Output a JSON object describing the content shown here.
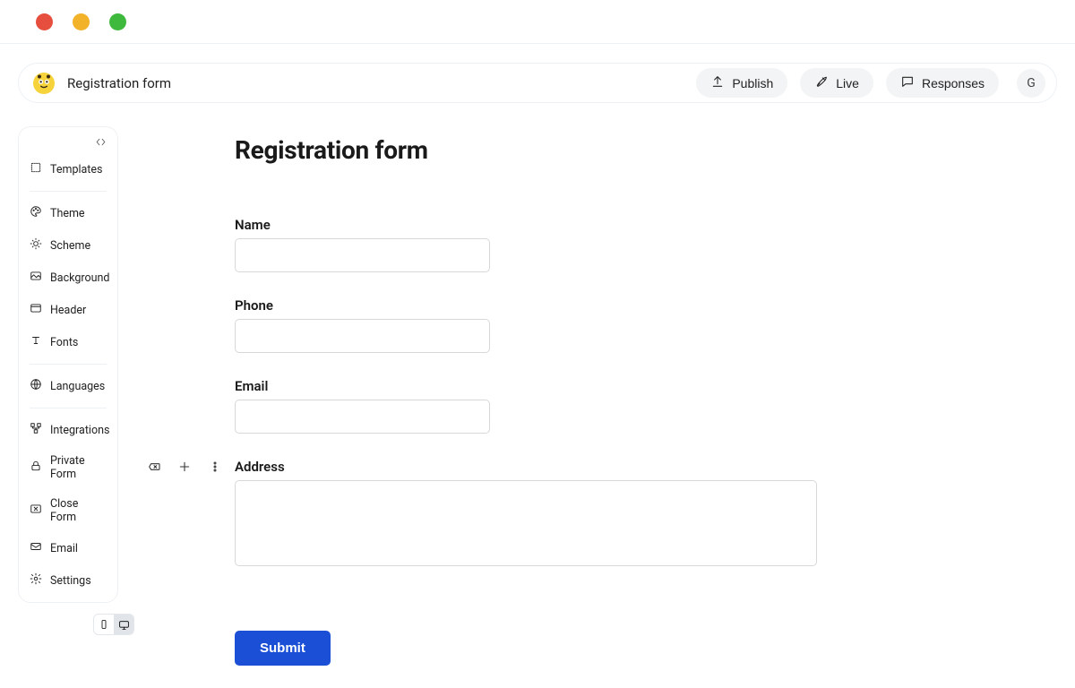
{
  "header": {
    "form_title": "Registration form",
    "publish_label": "Publish",
    "live_label": "Live",
    "responses_label": "Responses",
    "avatar_initial": "G"
  },
  "sidebar": {
    "templates": "Templates",
    "theme": "Theme",
    "scheme": "Scheme",
    "background": "Background",
    "header_opt": "Header",
    "fonts": "Fonts",
    "languages": "Languages",
    "integrations": "Integrations",
    "private": "Private Form",
    "close": "Close Form",
    "email": "Email",
    "settings": "Settings"
  },
  "form": {
    "heading": "Registration form",
    "name_label": "Name",
    "phone_label": "Phone",
    "email_label": "Email",
    "address_label": "Address",
    "submit_label": "Submit"
  }
}
